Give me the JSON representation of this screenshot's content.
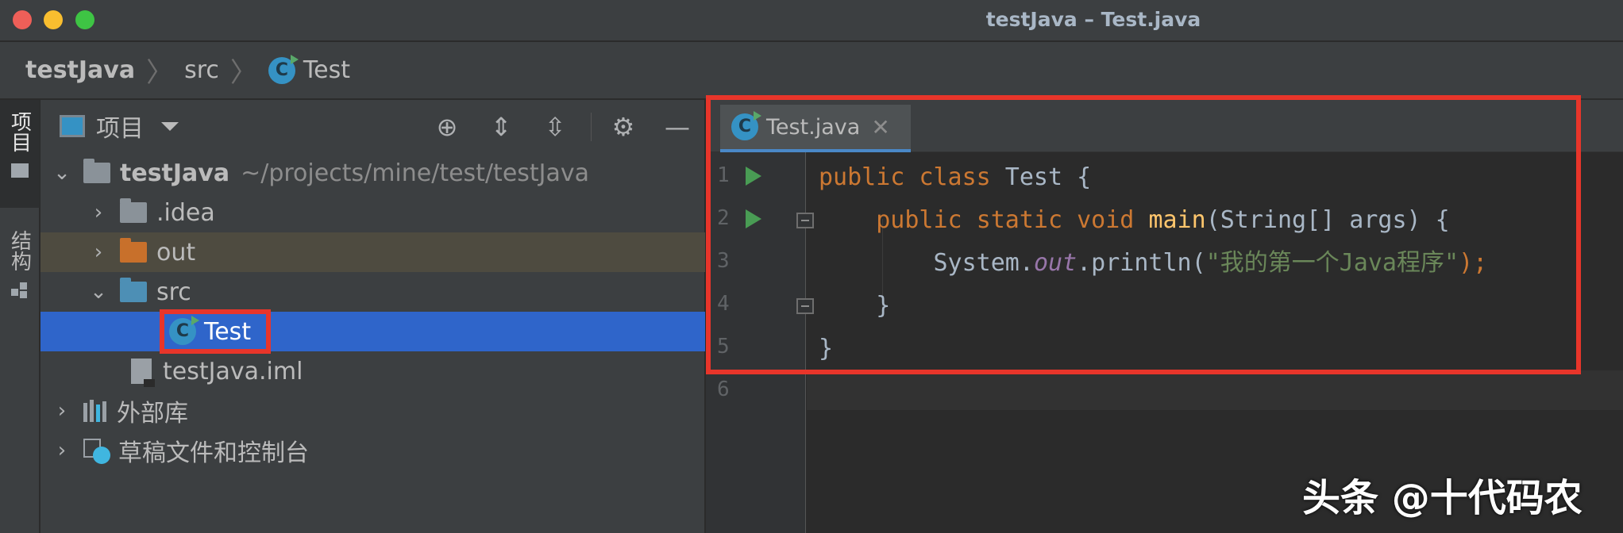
{
  "window": {
    "title": "testJava – Test.java"
  },
  "breadcrumb": {
    "project": "testJava",
    "folder": "src",
    "file": "Test"
  },
  "side_stripe": {
    "project_tab": "项目",
    "structure_tab": "结构"
  },
  "project_panel": {
    "title": "项目",
    "tree": [
      {
        "label": "testJava",
        "hint": "~/projects/mine/test/testJava",
        "expanded": true
      },
      {
        "label": ".idea"
      },
      {
        "label": "out"
      },
      {
        "label": "src",
        "expanded": true
      },
      {
        "label": "Test",
        "selected": true
      },
      {
        "label": "testJava.iml"
      },
      {
        "label": "外部库"
      },
      {
        "label": "草稿文件和控制台"
      }
    ]
  },
  "editor": {
    "tab_label": "Test.java",
    "line_numbers": [
      "1",
      "2",
      "3",
      "4",
      "5",
      "6"
    ],
    "code": {
      "l1_kw1": "public",
      "l1_kw2": "class",
      "l1_rest": " Test {",
      "l2_kw1": "public",
      "l2_kw2": "static",
      "l2_kw3": "void",
      "l2_fn": "main",
      "l2_rest": "(String[] args) {",
      "l3_a": "System.",
      "l3_field": "out",
      "l3_b": ".println(",
      "l3_str": "\"我的第一个Java程序\"",
      "l3_c": ");",
      "l4": "}",
      "l5": "}"
    }
  },
  "watermark": "头条 @十代码农",
  "colors": {
    "keyword": "#cc7832",
    "method": "#ffc66d",
    "string": "#6a8759",
    "field": "#9876aa",
    "selection": "#2f65ca",
    "highlight_box": "#e8352a"
  }
}
